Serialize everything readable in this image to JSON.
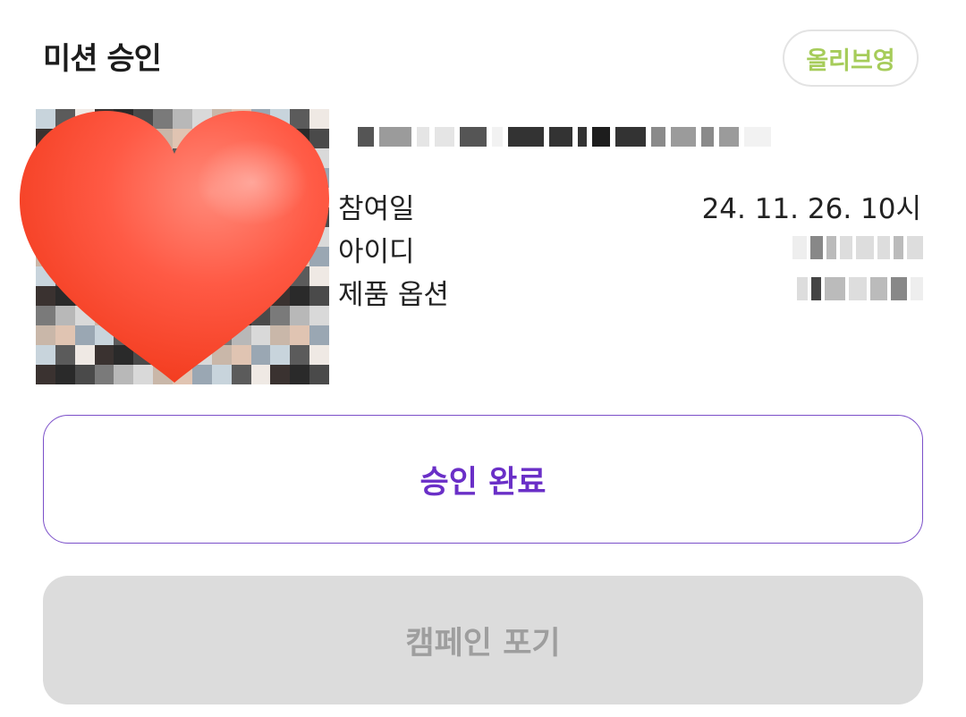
{
  "header": {
    "title": "미션 승인",
    "brand": "올리브영"
  },
  "details": {
    "participation_date_label": "참여일",
    "participation_date_value": "24. 11. 26. 10시",
    "user_id_label": "아이디",
    "product_option_label": "제품 옵션"
  },
  "actions": {
    "approve_label": "승인 완료",
    "give_up_label": "캠페인 포기"
  },
  "colors": {
    "brand_text": "#a6cc5a",
    "accent_purple": "#6a2fc7",
    "disabled_bg": "#dcdcdc",
    "disabled_text": "#9e9e9e",
    "heart": "#ff4a33"
  }
}
